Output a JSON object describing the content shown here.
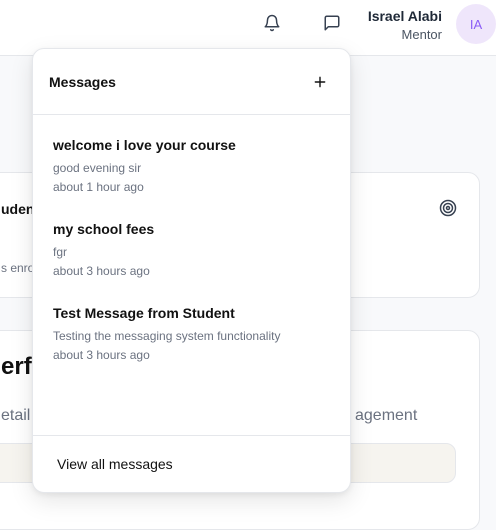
{
  "header": {
    "user_name": "Israel Alabi",
    "user_role": "Mentor",
    "avatar_initials": "IA"
  },
  "background": {
    "card1_title": "udent",
    "card1_sub": "s enrol",
    "card2_title": "erfo",
    "card2_desc": "etail",
    "card2_right": "agement"
  },
  "messages_dropdown": {
    "title": "Messages",
    "items": [
      {
        "title": "welcome i love your course",
        "body": "good evening sir",
        "time": "about 1 hour ago"
      },
      {
        "title": "my school fees",
        "body": "fgr",
        "time": "about 3 hours ago"
      },
      {
        "title": "Test Message from Student",
        "body": "Testing the messaging system functionality",
        "time": "about 3 hours ago"
      }
    ],
    "view_all_label": "View all messages"
  },
  "colors": {
    "avatar_bg": "#efe6fb",
    "avatar_text": "#8b5cf6",
    "border": "#e5e7eb"
  }
}
